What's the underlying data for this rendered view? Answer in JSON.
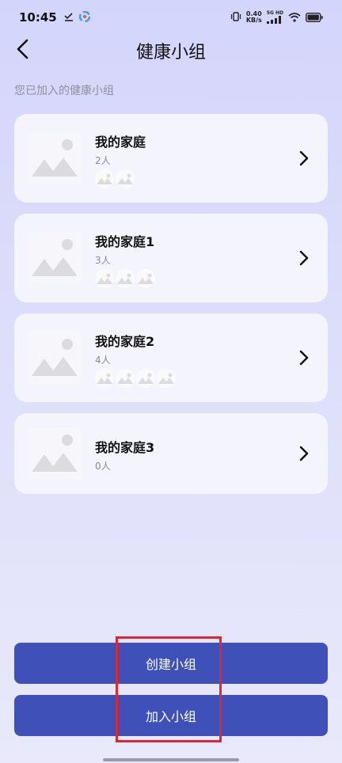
{
  "status_bar": {
    "time": "10:45",
    "net_speed_value": "0.40",
    "net_speed_unit": "KB/s",
    "network_label": "5G HD",
    "battery": "battery-icon"
  },
  "header": {
    "title": "健康小组",
    "back_icon": "chevron-left-icon"
  },
  "section_label": "您已加入的健康小组",
  "groups": [
    {
      "name": "我的家庭",
      "count": "2人",
      "avatars": 2
    },
    {
      "name": "我的家庭1",
      "count": "3人",
      "avatars": 3
    },
    {
      "name": "我的家庭2",
      "count": "4人",
      "avatars": 4
    },
    {
      "name": "我的家庭3",
      "count": "0人",
      "avatars": 0
    }
  ],
  "buttons": {
    "create": "创建小组",
    "join": "加入小组"
  },
  "colors": {
    "primary_button": "#3f51b8",
    "highlight": "#e22330",
    "card_bg": "#f4f4fe"
  }
}
